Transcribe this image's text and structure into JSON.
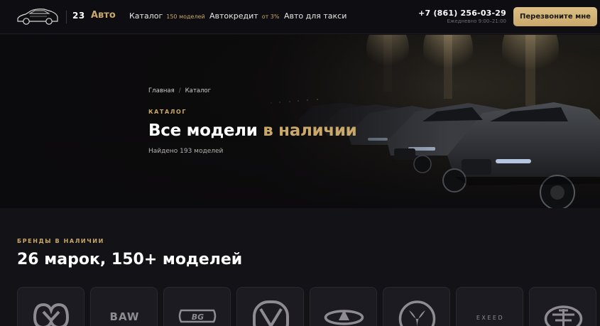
{
  "header": {
    "brand_number": "23",
    "brand_name": "Авто",
    "nav": [
      {
        "label": "Каталог",
        "sub": "150 моделей"
      },
      {
        "label": "Автокредит",
        "sub": "от 3%"
      },
      {
        "label": "Авто для такси",
        "sub": ""
      }
    ],
    "phone": "+7 (861) 256-03-29",
    "hours": "Ежедневно 9:00–21:00",
    "callback_label": "Перезвоните мне"
  },
  "hero": {
    "breadcrumb": [
      "Главная",
      "Каталог"
    ],
    "eyebrow": "КАТАЛОГ",
    "title_main": "Все модели ",
    "title_accent": "в наличии",
    "found": "Найдено 193 моделей"
  },
  "brands": {
    "eyebrow": "БРЕНДЫ В НАЛИЧИИ",
    "title": "26 марок, 150+ моделей",
    "items": [
      {
        "name": "jetour-logo",
        "text": ""
      },
      {
        "name": "baw-logo",
        "text": "BAW"
      },
      {
        "name": "bg-logo",
        "text": "BG"
      },
      {
        "name": "changan-logo",
        "text": ""
      },
      {
        "name": "chery-logo",
        "text": ""
      },
      {
        "name": "dongfeng-logo",
        "text": ""
      },
      {
        "name": "exeed-logo",
        "text": "EXEED"
      },
      {
        "name": "faw-logo",
        "text": ""
      }
    ]
  },
  "colors": {
    "accent": "#c9a86a",
    "background": "#0f0e13",
    "card": "#1c1b21"
  }
}
